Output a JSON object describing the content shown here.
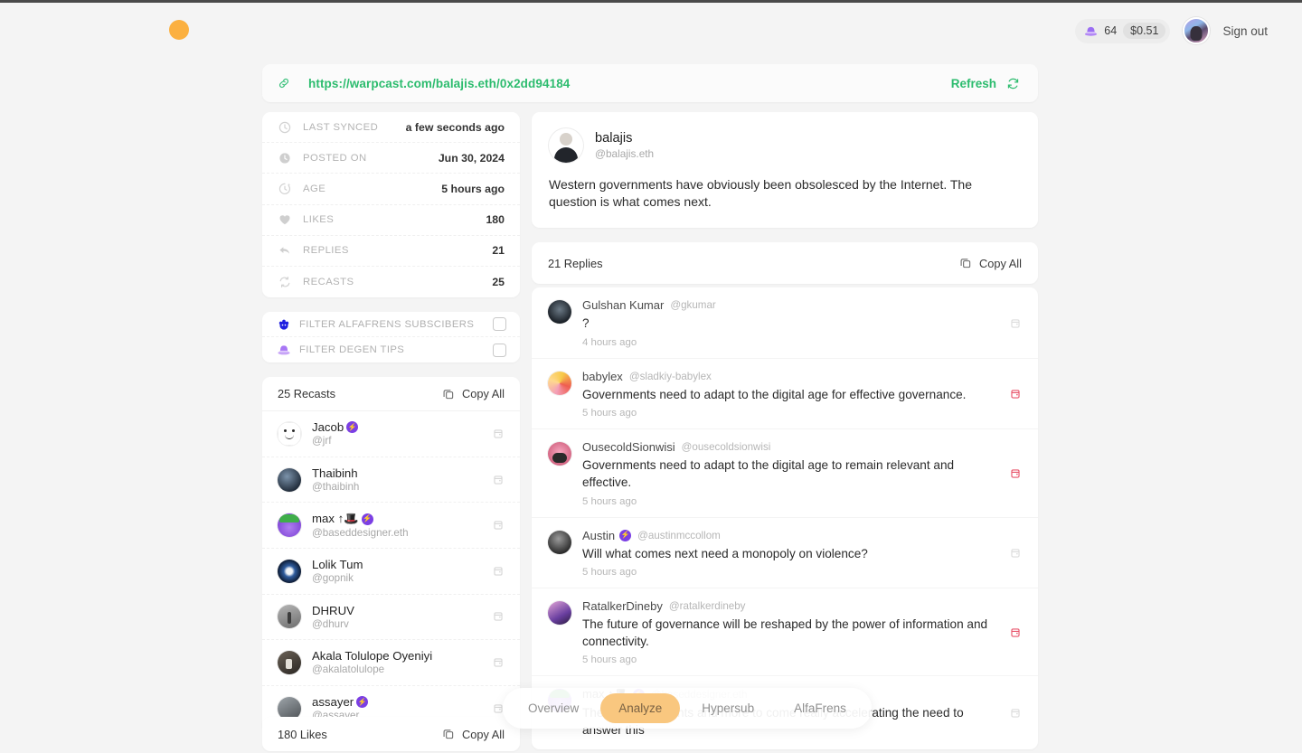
{
  "header": {
    "brand_icon": "orange-dot-logo",
    "degen_icon": "degen-hat-icon",
    "degen_count": "64",
    "degen_usd": "$0.51",
    "signout_label": "Sign out",
    "avatar_icon": "user-avatar"
  },
  "urlbar": {
    "link_icon": "link-icon",
    "url": "https://warpcast.com/balajis.eth/0x2dd94184",
    "refresh_label": "Refresh",
    "refresh_icon": "refresh-icon",
    "accent_color": "#2cbc6e"
  },
  "stats": [
    {
      "icon": "clock-outline-icon",
      "label": "LAST SYNCED",
      "value": "a few seconds ago"
    },
    {
      "icon": "clock-filled-icon",
      "label": "POSTED ON",
      "value": "Jun 30, 2024"
    },
    {
      "icon": "timer-icon",
      "label": "AGE",
      "value": "5 hours ago"
    },
    {
      "icon": "heart-icon",
      "label": "LIKES",
      "value": "180"
    },
    {
      "icon": "reply-arrow-icon",
      "label": "REPLIES",
      "value": "21"
    },
    {
      "icon": "recast-icon",
      "label": "RECASTS",
      "value": "25"
    }
  ],
  "filters": [
    {
      "icon": "alfafrens-icon",
      "label": "FILTER ALFAFRENS SUBSCIBERS",
      "checked": false
    },
    {
      "icon": "degen-hat-icon",
      "label": "FILTER DEGEN TIPS",
      "checked": false
    }
  ],
  "recasts": {
    "title": "25 Recasts",
    "copy_all_label": "Copy All",
    "copy_icon": "copy-icon",
    "people": [
      {
        "name": "Jacob",
        "handle": "@jrf",
        "badge": true,
        "avatar": "smiley-avatar"
      },
      {
        "name": "Thaibinh",
        "handle": "@thaibinh",
        "badge": false,
        "avatar": "dark-portrait-avatar"
      },
      {
        "name": "max ↑🎩",
        "handle": "@baseddesigner.eth",
        "badge": true,
        "avatar": "purple-pepe-avatar"
      },
      {
        "name": "Lolik Tum",
        "handle": "@gopnik",
        "badge": false,
        "avatar": "blue-eye-avatar"
      },
      {
        "name": "DHRUV",
        "handle": "@dhurv",
        "badge": false,
        "avatar": "grey-figure-avatar"
      },
      {
        "name": "Akala Tolulope Oyeniyi",
        "handle": "@akalatolulope",
        "badge": false,
        "avatar": "street-photo-avatar"
      },
      {
        "name": "assayer",
        "handle": "@assayer",
        "badge": true,
        "avatar": "group-photo-avatar"
      }
    ]
  },
  "likes": {
    "title": "180 Likes",
    "copy_all_label": "Copy All",
    "copy_icon": "copy-icon"
  },
  "post": {
    "author_name": "balajis",
    "author_handle": "@balajis.eth",
    "avatar": "suit-portrait-avatar",
    "text": "Western governments have obviously been obsolesced by the Internet. The question is what comes next."
  },
  "replies_header": {
    "count_label": "21 Replies",
    "copy_all_label": "Copy All",
    "copy_icon": "copy-icon"
  },
  "replies": [
    {
      "name": "Gulshan Kumar",
      "handle": "@gkumar",
      "badge": false,
      "text": "?",
      "time": "4 hours ago",
      "flagged": false,
      "avatar": "friends-photo-avatar"
    },
    {
      "name": "babylex",
      "handle": "@sladkiy-babylex",
      "badge": false,
      "text": "Governments need to adapt to the digital age for effective governance.",
      "time": "5 hours ago",
      "flagged": true,
      "avatar": "colorful-anime-avatar"
    },
    {
      "name": "OusecoldSionwisi",
      "handle": "@ousecoldsionwisi",
      "badge": false,
      "text": "Governments need to adapt to the digital age to remain relevant and effective.",
      "time": "5 hours ago",
      "flagged": true,
      "avatar": "pink-character-avatar"
    },
    {
      "name": "Austin",
      "handle": "@austinmccollom",
      "badge": true,
      "text": "Will what comes next need a monopoly on violence?",
      "time": "5 hours ago",
      "flagged": false,
      "avatar": "bw-portrait-avatar"
    },
    {
      "name": "RatalkerDineby",
      "handle": "@ratalkerdineby",
      "badge": false,
      "text": "The future of governance will be reshaped by the power of information and connectivity.",
      "time": "5 hours ago",
      "flagged": true,
      "avatar": "purple-figure-avatar"
    },
    {
      "name": "max ↑🎩",
      "handle": "@baseddesigner.eth",
      "badge": true,
      "text": "These recent events and more to come really accelerating the need to answer this",
      "time": "",
      "flagged": false,
      "avatar": "purple-pepe-avatar"
    }
  ],
  "tabs": [
    {
      "label": "Overview",
      "active": false
    },
    {
      "label": "Analyze",
      "active": true
    },
    {
      "label": "Hypersub",
      "active": false
    },
    {
      "label": "AlfaFrens",
      "active": false
    }
  ],
  "colors": {
    "page_bg": "#f4f4f4",
    "accent_green": "#2cbc6e",
    "accent_orange": "#f9c77f",
    "flag_red": "#e8546b",
    "badge_purple": "#7b3fe4"
  }
}
